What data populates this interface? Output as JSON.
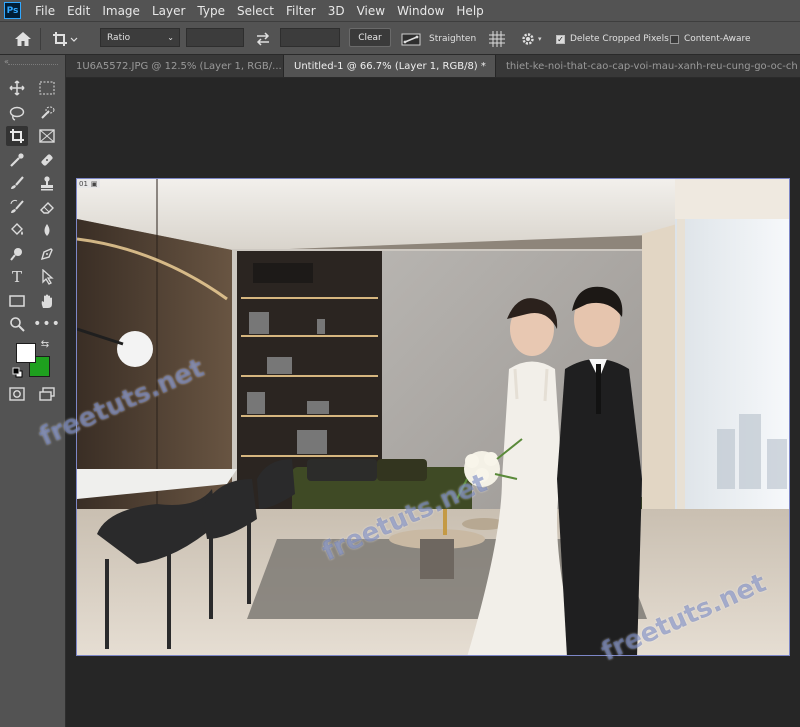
{
  "app": {
    "logo": "Ps"
  },
  "menu": [
    "File",
    "Edit",
    "Image",
    "Layer",
    "Type",
    "Select",
    "Filter",
    "3D",
    "View",
    "Window",
    "Help"
  ],
  "options": {
    "home_icon": "home-icon",
    "tool_icon": "crop-icon",
    "ratio_value": "Ratio",
    "width_value": "",
    "height_value": "",
    "clear_label": "Clear",
    "straighten_label": "Straighten",
    "delete_cropped_label": "Delete Cropped Pixels",
    "delete_cropped_checked": true,
    "content_aware_label": "Content-Aware",
    "content_aware_checked": false
  },
  "tabs": [
    {
      "label": "1U6A5572.JPG @ 12.5% (Layer 1, RGB/...",
      "active": false
    },
    {
      "label": "Untitled-1 @ 66.7% (Layer 1, RGB/8) *",
      "active": true
    },
    {
      "label": "thiet-ke-noi-that-cao-cap-voi-mau-xanh-reu-cung-go-oc-ch",
      "active": false
    }
  ],
  "tools": [
    "move-icon",
    "marquee-icon",
    "lasso-icon",
    "quick-select-icon",
    "crop-icon",
    "frame-icon",
    "eyedropper-icon",
    "healing-icon",
    "brush-icon",
    "stamp-icon",
    "history-brush-icon",
    "eraser-icon",
    "paint-bucket-icon",
    "blur-icon",
    "dodge-icon",
    "pen-icon",
    "type-icon",
    "path-select-icon",
    "rectangle-icon",
    "hand-icon",
    "zoom-icon",
    "more-icon"
  ],
  "colors": {
    "foreground": "#ffffff",
    "background": "#1ea01e",
    "ui_bg": "#535353",
    "workspace": "#262626"
  },
  "document": {
    "artboard_label": "01"
  },
  "watermark": "freetuts.net"
}
